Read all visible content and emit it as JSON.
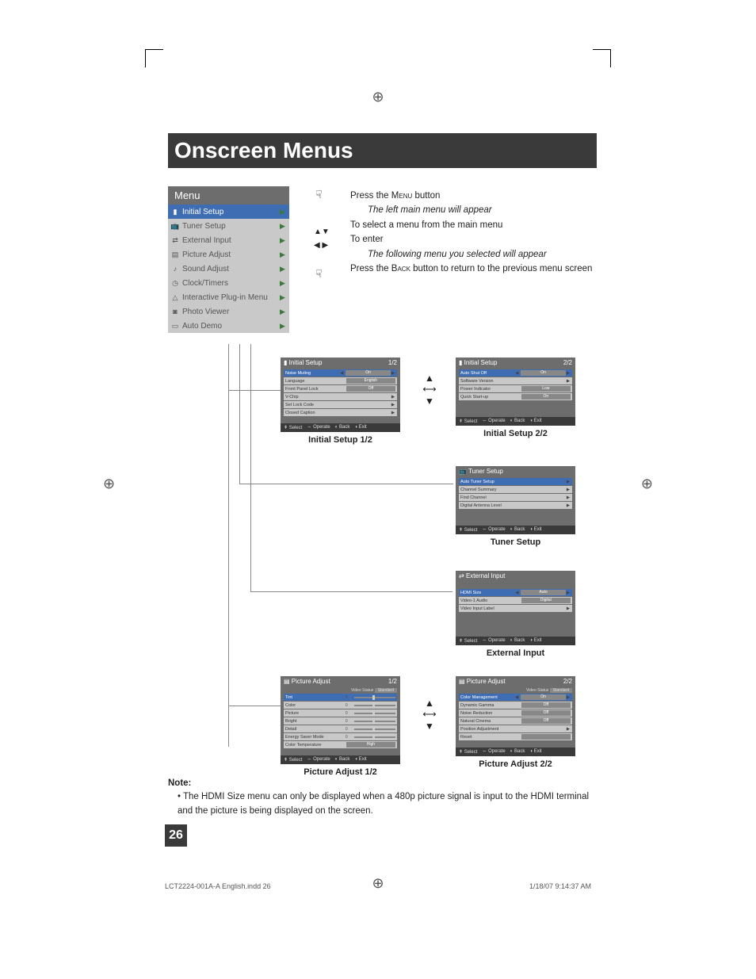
{
  "header": "Onscreen Menus",
  "main_menu": {
    "title": "Menu",
    "items": [
      "Initial Setup",
      "Tuner Setup",
      "External Input",
      "Picture Adjust",
      "Sound Adjust",
      "Clock/Timers",
      "Interactive Plug-in Menu",
      "Photo Viewer",
      "Auto Demo"
    ]
  },
  "instructions": {
    "l1a": "Press the ",
    "l1b": "Menu",
    "l1c": " button",
    "l2": "The left main menu will appear",
    "l3": "To select a menu from the main menu",
    "l4": "To enter",
    "l5": "The following menu you selected will appear",
    "l6a": "Press the ",
    "l6b": "Back",
    "l6c": " button to return to the previous menu screen"
  },
  "nav_icons": {
    "ud": "▲▼",
    "lr": "◀ ▶"
  },
  "screens": {
    "initial1": {
      "title": "Initial Setup",
      "page": "1/2",
      "caption": "Initial Setup 1/2",
      "rows": [
        {
          "k": "Noise Muting",
          "v": "On"
        },
        {
          "k": "Language",
          "v": "English"
        },
        {
          "k": "Front Panel Lock",
          "v": "Off"
        },
        {
          "k": "V-Chip",
          "v": "▶"
        },
        {
          "k": "Set Lock Code",
          "v": "▶"
        },
        {
          "k": "Closed Caption",
          "v": "▶"
        }
      ]
    },
    "initial2": {
      "title": "Initial Setup",
      "page": "2/2",
      "caption": "Initial Setup 2/2",
      "rows": [
        {
          "k": "Auto Shut Off",
          "v": "On"
        },
        {
          "k": "Software Version",
          "v": "▶"
        },
        {
          "k": "Power Indicator",
          "v": "Low"
        },
        {
          "k": "Quick Start-up",
          "v": "On"
        }
      ]
    },
    "tuner": {
      "title": "Tuner Setup",
      "page": "",
      "caption": "Tuner Setup",
      "rows": [
        {
          "k": "Auto Tuner Setup",
          "v": "▶"
        },
        {
          "k": "Channel Summary",
          "v": "▶"
        },
        {
          "k": "Find Channel",
          "v": "▶"
        },
        {
          "k": "Digital Antenna Level",
          "v": "▶"
        }
      ]
    },
    "external": {
      "title": "External Input",
      "page": "",
      "caption": "External Input",
      "rows": [
        {
          "k": "HDMI Size",
          "v": "Auto"
        },
        {
          "k": "Video-1 Audio",
          "v": "Digital"
        },
        {
          "k": "Video Input Label",
          "v": "▶"
        }
      ]
    },
    "picture1": {
      "title": "Picture Adjust",
      "page": "1/2",
      "caption": "Picture Adjust 1/2",
      "status_label": "Video Status",
      "status_value": "Standard",
      "rows": [
        {
          "k": "Tint",
          "n": "0"
        },
        {
          "k": "Color",
          "n": "0"
        },
        {
          "k": "Picture",
          "n": "0"
        },
        {
          "k": "Bright",
          "n": "0"
        },
        {
          "k": "Detail",
          "n": "0"
        },
        {
          "k": "Energy Saver Mode",
          "n": "0"
        },
        {
          "k": "Color Temperature",
          "v": "High"
        }
      ]
    },
    "picture2": {
      "title": "Picture Adjust",
      "page": "2/2",
      "caption": "Picture Adjust 2/2",
      "status_label": "Video Status",
      "status_value": "Standard",
      "rows": [
        {
          "k": "Color Management",
          "v": "On"
        },
        {
          "k": "Dynamic Gamma",
          "v": "Off"
        },
        {
          "k": "Noise Reduction",
          "v": "Off"
        },
        {
          "k": "Natural Cinema",
          "v": "Off"
        },
        {
          "k": "Position Adjustment",
          "v": "▶"
        },
        {
          "k": "Reset",
          "v": ""
        }
      ]
    }
  },
  "footer_labels": {
    "select": "Select",
    "operate": "Operate",
    "back": "Back",
    "exit": "Exit"
  },
  "note": {
    "heading": "Note:",
    "body": "The HDMI Size menu can only be displayed when a 480p picture signal is input to the HDMI terminal and the picture is being displayed on the screen."
  },
  "page_number": "26",
  "file_footer": {
    "name": "LCT2224-001A-A English.indd   26",
    "time": "1/18/07   9:14:37 AM"
  }
}
